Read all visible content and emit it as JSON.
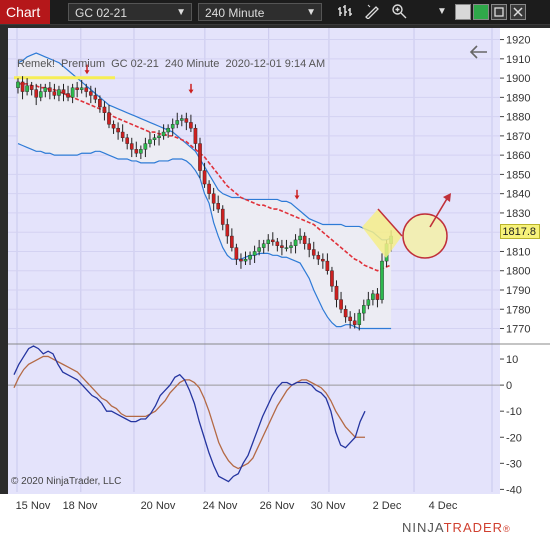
{
  "toolbar": {
    "chart_tab": "Chart",
    "instrument": "GC 02-21",
    "interval": "240 Minute",
    "icons": [
      "bar-chart-icon",
      "draw-tool-icon",
      "zoom-icon",
      "dropdown-icon",
      "window-restore-icon",
      "color-swatch-icon",
      "maximize-icon",
      "close-icon"
    ]
  },
  "chart_info": "Remek!  Premium  GC 02-21  240 Minute  2020-12-01 9:14 AM",
  "price_label": "1817.8",
  "copyright": "© 2020 NinjaTrader, LLC",
  "brand": {
    "ninja": "NINJA",
    "trader": "TRADER",
    "registered": "®"
  },
  "colors": {
    "up_candle": "#2db84d",
    "down_candle": "#cc2020",
    "band": "#2e7bd6",
    "midline": "#e0313a",
    "osc_fast": "#2535a0",
    "osc_slow": "#b46a45",
    "background": "#e4e3fb",
    "accent": "#b5171a"
  },
  "chart_data": [
    {
      "type": "candlestick",
      "y_ticks": [
        1920,
        1910,
        1900,
        1890,
        1880,
        1870,
        1860,
        1850,
        1840,
        1830,
        1820,
        1810,
        1800,
        1790,
        1780,
        1770
      ],
      "x_ticks": [
        "15 Nov",
        "18 Nov",
        "20 Nov",
        "24 Nov",
        "26 Nov",
        "30 Nov",
        "2 Dec",
        "4 Dec"
      ],
      "ylim": [
        1763,
        1926
      ],
      "closes": [
        1898,
        1893,
        1896,
        1894,
        1890,
        1893,
        1895,
        1893,
        1891,
        1894,
        1892,
        1890,
        1895,
        1894,
        1895,
        1893,
        1891,
        1889,
        1885,
        1882,
        1876,
        1874,
        1872,
        1869,
        1866,
        1863,
        1861,
        1863,
        1866,
        1868,
        1869,
        1870,
        1872,
        1874,
        1876,
        1878,
        1879,
        1877,
        1874,
        1866,
        1852,
        1845,
        1840,
        1835,
        1832,
        1824,
        1818,
        1812,
        1806,
        1805,
        1806,
        1808,
        1810,
        1812,
        1814,
        1816,
        1815,
        1813,
        1812,
        1812,
        1813,
        1816,
        1818,
        1814,
        1811,
        1808,
        1806,
        1805,
        1800,
        1792,
        1785,
        1780,
        1776,
        1774,
        1772,
        1778,
        1782,
        1785,
        1788,
        1785,
        1805,
        1814,
        1818
      ],
      "upper_band": [
        1908,
        1909,
        1911,
        1912,
        1913,
        1912,
        1911,
        1910,
        1909,
        1908,
        1906,
        1904,
        1902,
        1900,
        1898,
        1896,
        1894,
        1892,
        1890,
        1888,
        1886,
        1885,
        1884,
        1883,
        1882,
        1881,
        1880,
        1879,
        1878,
        1877,
        1876,
        1875,
        1874,
        1873,
        1872,
        1870,
        1868,
        1866,
        1864,
        1862,
        1858,
        1854,
        1850,
        1846,
        1842,
        1840,
        1839,
        1838,
        1838,
        1838,
        1837,
        1837,
        1837,
        1837,
        1837,
        1837,
        1837,
        1837,
        1836,
        1836,
        1835,
        1833,
        1831,
        1829,
        1827,
        1826,
        1825,
        1824,
        1824,
        1824,
        1824,
        1824,
        1823,
        1823,
        1823,
        1823,
        1822,
        1821,
        1820,
        1818,
        1816,
        1816,
        1817
      ],
      "mid_line": [
        1897,
        1897,
        1897,
        1896,
        1896,
        1895,
        1895,
        1894,
        1894,
        1893,
        1892,
        1891,
        1890,
        1889,
        1888,
        1887,
        1886,
        1885,
        1884,
        1883,
        1882,
        1880,
        1879,
        1878,
        1877,
        1876,
        1875,
        1874,
        1873,
        1872,
        1872,
        1871,
        1871,
        1870,
        1870,
        1869,
        1868,
        1867,
        1865,
        1863,
        1861,
        1859,
        1856,
        1853,
        1850,
        1847,
        1844,
        1842,
        1840,
        1838,
        1837,
        1836,
        1835,
        1834,
        1834,
        1833,
        1832,
        1832,
        1831,
        1830,
        1829,
        1828,
        1827,
        1826,
        1825,
        1824,
        1822,
        1820,
        1818,
        1816,
        1814,
        1812,
        1810,
        1808,
        1806,
        1805,
        1803,
        1802,
        1801,
        1800,
        1801,
        1802,
        1803
      ],
      "lower_band": [
        1866,
        1865,
        1864,
        1863,
        1862,
        1862,
        1861,
        1861,
        1860,
        1860,
        1860,
        1860,
        1860,
        1860,
        1861,
        1861,
        1861,
        1862,
        1862,
        1861,
        1860,
        1859,
        1858,
        1858,
        1858,
        1857,
        1857,
        1856,
        1856,
        1856,
        1856,
        1857,
        1857,
        1857,
        1858,
        1858,
        1858,
        1857,
        1855,
        1852,
        1848,
        1840,
        1835,
        1825,
        1818,
        1812,
        1808,
        1806,
        1806,
        1806,
        1807,
        1808,
        1808,
        1809,
        1809,
        1809,
        1808,
        1808,
        1807,
        1807,
        1806,
        1805,
        1804,
        1800,
        1796,
        1790,
        1785,
        1780,
        1776,
        1773,
        1771,
        1771,
        1772,
        1772,
        1771,
        1770,
        1770,
        1770,
        1770,
        1770,
        1770,
        1770,
        1770
      ]
    },
    {
      "type": "line",
      "y_ticks": [
        10,
        0,
        -10,
        -20,
        -30,
        -40
      ],
      "ylim": [
        -41,
        15
      ],
      "series": [
        {
          "values": [
            4,
            8,
            11,
            14,
            15,
            14,
            12,
            13,
            12,
            8,
            5,
            4,
            3,
            2,
            0,
            -2,
            -4,
            -5,
            -7,
            -10,
            -10,
            -11,
            -12,
            -13,
            -14,
            -14,
            -13,
            -13,
            -11,
            -8,
            -4,
            -2,
            0,
            3,
            4,
            2,
            -2,
            -7,
            -14,
            -20,
            -26,
            -31,
            -35,
            -36,
            -37,
            -35,
            -34,
            -30,
            -27,
            -22,
            -17,
            -12,
            -8,
            -4,
            -1,
            1,
            1,
            0,
            1,
            1,
            1,
            0,
            -2,
            -3,
            -5,
            -10,
            -18,
            -23,
            -24,
            -22,
            -20,
            -14,
            -10
          ]
        },
        {
          "values": [
            -1,
            3,
            6,
            8,
            9,
            10,
            11,
            11,
            10,
            9,
            8,
            7,
            6,
            5,
            3,
            1,
            -1,
            -3,
            -5,
            -6,
            -8,
            -9,
            -11,
            -12,
            -12,
            -12,
            -12,
            -12,
            -11,
            -10,
            -8,
            -6,
            -3,
            -1,
            1,
            2,
            2,
            1,
            -1,
            -5,
            -10,
            -16,
            -22,
            -26,
            -29,
            -31,
            -32,
            -31,
            -30,
            -28,
            -24,
            -20,
            -16,
            -12,
            -8,
            -5,
            -2,
            0,
            1,
            2,
            2,
            1,
            0,
            -1,
            -3,
            -6,
            -10,
            -13,
            -16,
            -18,
            -20,
            -20,
            -20
          ]
        }
      ]
    }
  ]
}
